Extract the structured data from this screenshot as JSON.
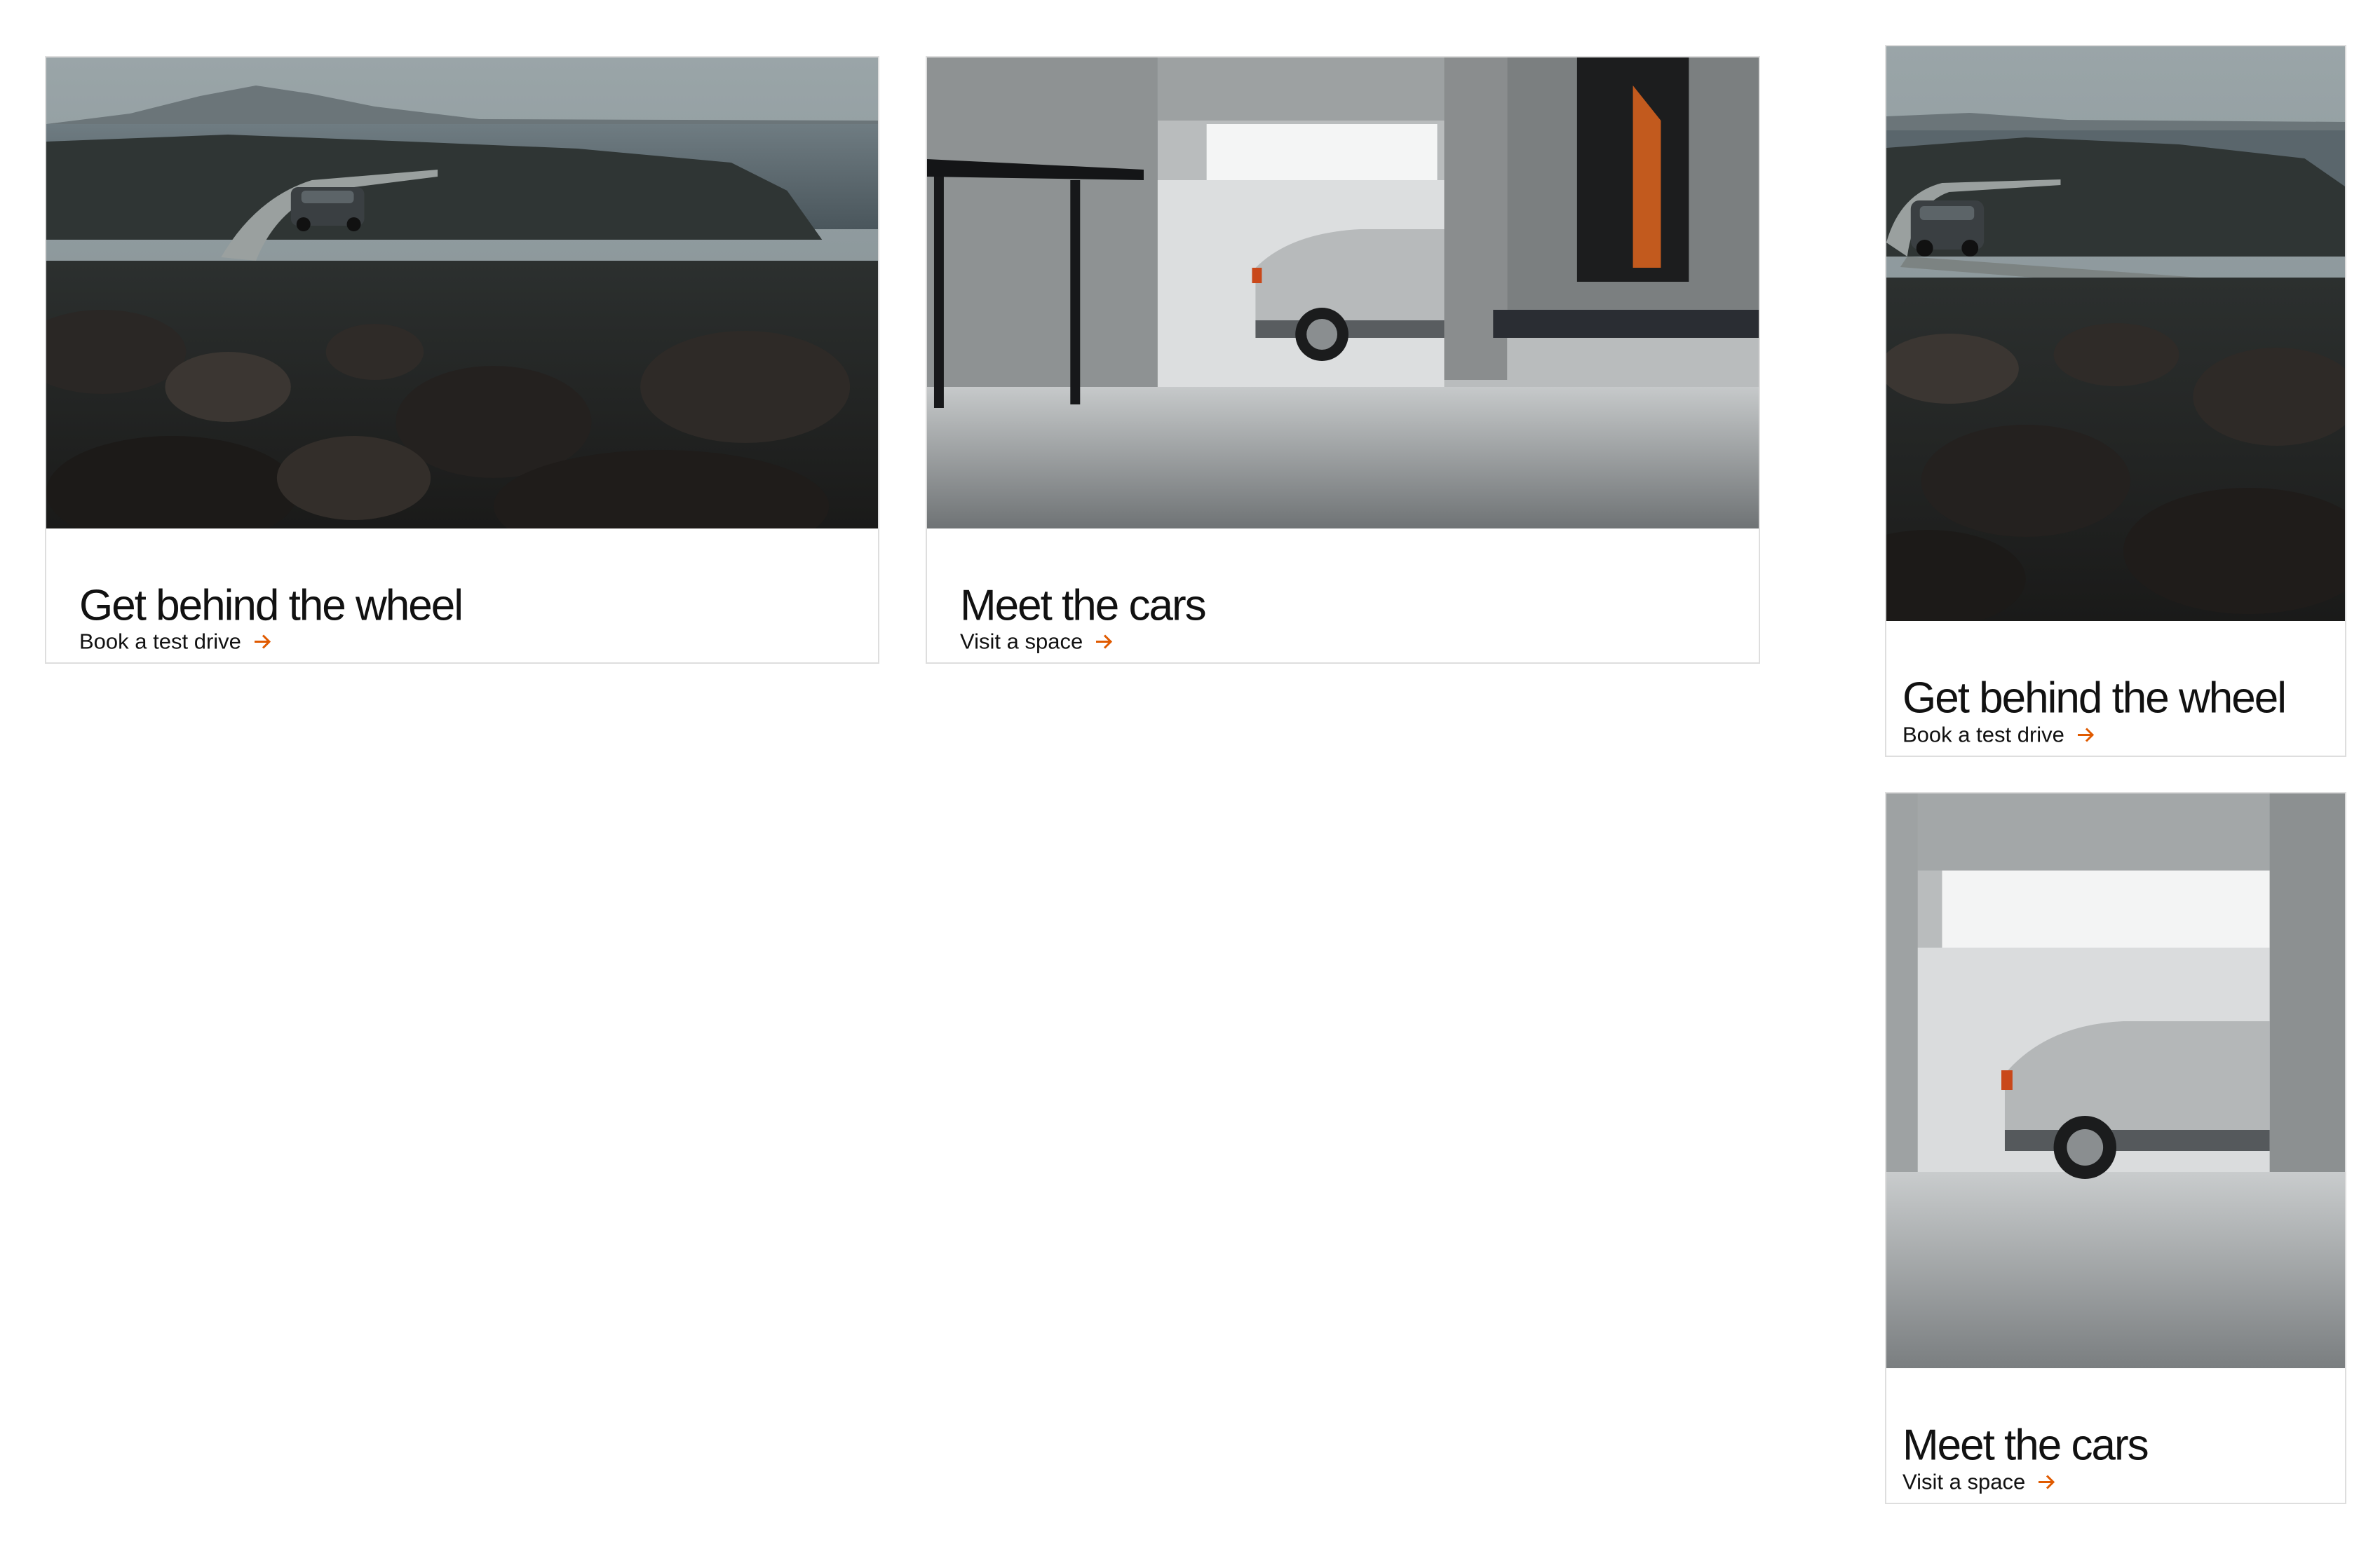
{
  "cards": [
    {
      "title": "Get behind the wheel",
      "cta": "Book a test drive",
      "image": "coastal-road-car-photo"
    },
    {
      "title": "Meet the cars",
      "cta": "Visit a space",
      "image": "showroom-car-photo"
    },
    {
      "title": "Get behind the wheel",
      "cta": "Book a test drive",
      "image": "coastal-road-car-photo"
    },
    {
      "title": "Meet the cars",
      "cta": "Visit a space",
      "image": "showroom-car-photo"
    }
  ],
  "icons": {
    "cta": "arrow-right-icon"
  },
  "colors": {
    "accent": "#e05a00",
    "text": "#111111",
    "border": "#dedede",
    "background": "#ffffff"
  }
}
